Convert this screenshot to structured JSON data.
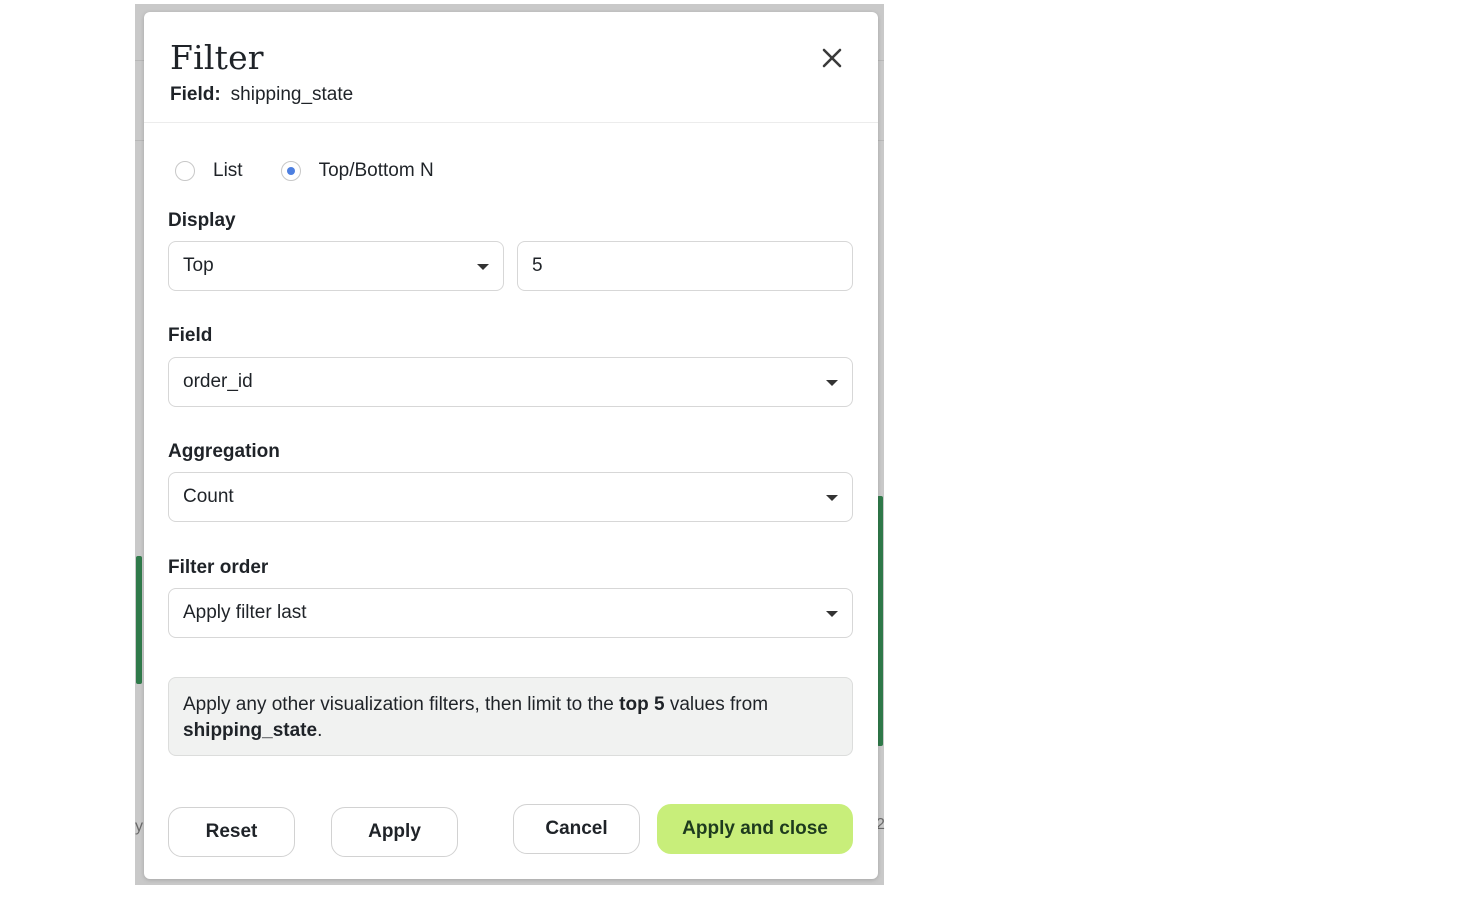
{
  "dialog": {
    "title": "Filter",
    "field_label": "Field:",
    "field_value": "shipping_state",
    "close_icon": "close-icon"
  },
  "mode": {
    "options": [
      {
        "label": "List",
        "selected": false
      },
      {
        "label": "Top/Bottom N",
        "selected": true
      }
    ]
  },
  "display": {
    "label": "Display",
    "direction": "Top",
    "count": "5"
  },
  "field": {
    "label": "Field",
    "value": "order_id"
  },
  "aggregation": {
    "label": "Aggregation",
    "value": "Count"
  },
  "filter_order": {
    "label": "Filter order",
    "value": "Apply filter last"
  },
  "info": {
    "prefix": "Apply any other visualization filters, then limit to the ",
    "bold1": "top 5",
    "middle": " values from",
    "bold2": "shipping_state",
    "suffix": "."
  },
  "buttons": {
    "reset": "Reset",
    "apply": "Apply",
    "cancel": "Cancel",
    "apply_close": "Apply and close"
  },
  "background": {
    "left_tick": "y",
    "right_tick": "2"
  },
  "colors": {
    "primary_button": "#c8ee7a",
    "radio_accent": "#4d7fe0",
    "spark_line": "#2f7a4a"
  }
}
